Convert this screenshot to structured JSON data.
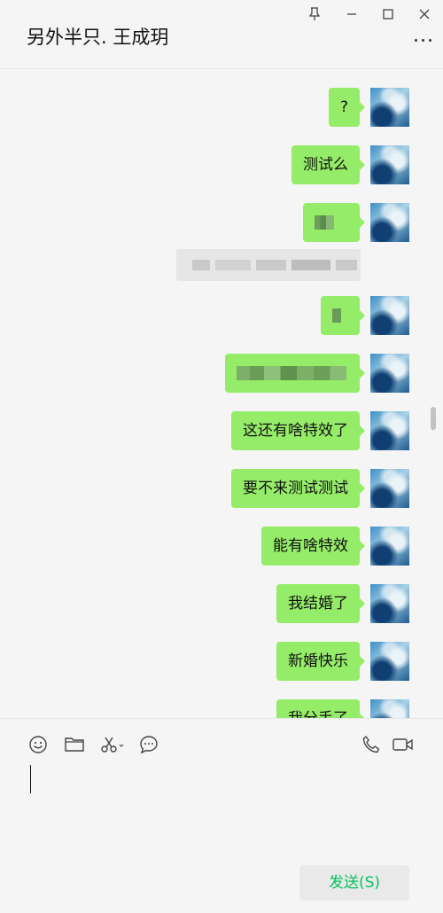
{
  "window": {
    "pin_icon": "pin-icon",
    "minimize_icon": "minimize-icon",
    "maximize_icon": "maximize-icon",
    "close_icon": "close-icon"
  },
  "header": {
    "title": "另外半只. 王成玥",
    "more_icon": "more-icon"
  },
  "messages": [
    {
      "text": "?",
      "blurred": false
    },
    {
      "text": "测试么",
      "blurred": false
    },
    {
      "text": "",
      "blurred": true
    },
    {
      "text": "",
      "blurred": true
    },
    {
      "text": "",
      "blurred": true
    },
    {
      "text": "这还有啥特效了",
      "blurred": false
    },
    {
      "text": "要不来测试测试",
      "blurred": false
    },
    {
      "text": "能有啥特效",
      "blurred": false
    },
    {
      "text": "我结婚了",
      "blurred": false
    },
    {
      "text": "新婚快乐",
      "blurred": false
    },
    {
      "text": "我分手了",
      "blurred": false
    }
  ],
  "toolbar": {
    "icons": [
      "emoji-icon",
      "folder-icon",
      "scissors-icon",
      "chat-history-icon",
      "phone-icon",
      "video-icon"
    ]
  },
  "composer": {
    "send_label": "发送(S)"
  },
  "colors": {
    "bubble": "#95ec69",
    "send_text": "#07c160",
    "background": "#f5f5f5"
  }
}
